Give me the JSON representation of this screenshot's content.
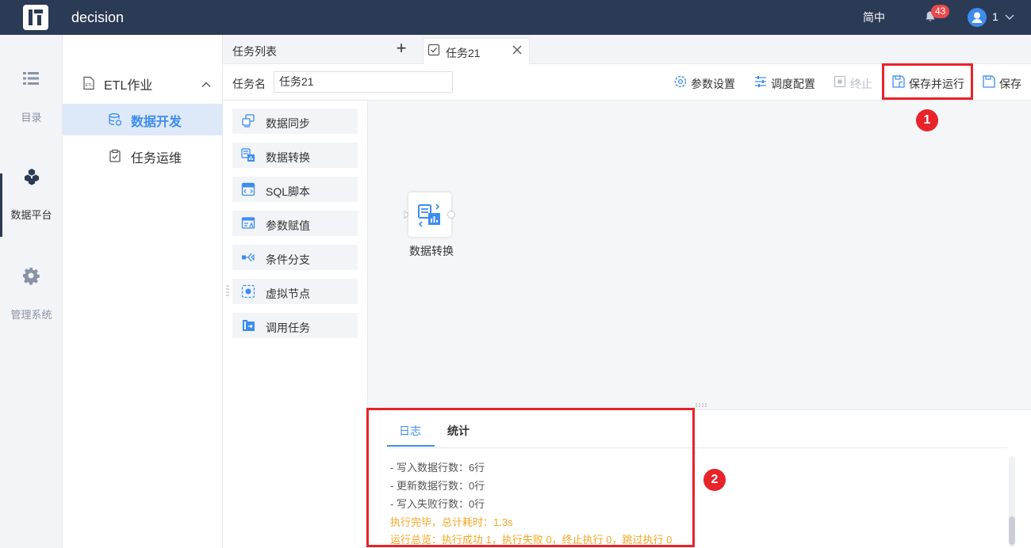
{
  "header": {
    "app_title": "decision",
    "language": "简中",
    "notification_count": "43",
    "user_name": "1"
  },
  "leftnav": {
    "items": [
      {
        "label": "目录",
        "icon": "list-icon"
      },
      {
        "label": "数据平台",
        "icon": "cube-icon"
      },
      {
        "label": "管理系统",
        "icon": "gear-icon"
      }
    ]
  },
  "submenu": {
    "group_label": "ETL作业",
    "items": [
      {
        "label": "数据开发",
        "icon": "database-icon"
      },
      {
        "label": "任务运维",
        "icon": "clipboard-check-icon"
      }
    ]
  },
  "tabs": {
    "list_label": "任务列表",
    "add_symbol": "+",
    "task_label": "任务21"
  },
  "toolbar": {
    "task_name_label": "任务名",
    "task_name_value": "任务21",
    "param_settings": "参数设置",
    "schedule_config": "调度配置",
    "stop": "终止",
    "save_and_run": "保存并运行",
    "save": "保存"
  },
  "palette": {
    "items": [
      {
        "label": "数据同步"
      },
      {
        "label": "数据转换"
      },
      {
        "label": "SQL脚本"
      },
      {
        "label": "参数赋值"
      },
      {
        "label": "条件分支"
      },
      {
        "label": "虚拟节点"
      },
      {
        "label": "调用任务"
      }
    ]
  },
  "canvas": {
    "node_label": "数据转换"
  },
  "log": {
    "tab_log": "日志",
    "tab_stats": "统计",
    "lines": [
      "- 写入数据行数：6行",
      "- 更新数据行数：0行",
      "- 写入失败行数：0行",
      "执行完毕，总计耗时：1.3s",
      "运行总览：执行成功 1，执行失败 0，终止执行 0，跳过执行 0"
    ]
  },
  "annotations": {
    "marker_1": "1",
    "marker_2": "2",
    "highlight_color": "#e8232a"
  },
  "colors": {
    "header_bg": "#2b3a55",
    "accent": "#3d8cf0",
    "warning_text": "#f5a623"
  }
}
